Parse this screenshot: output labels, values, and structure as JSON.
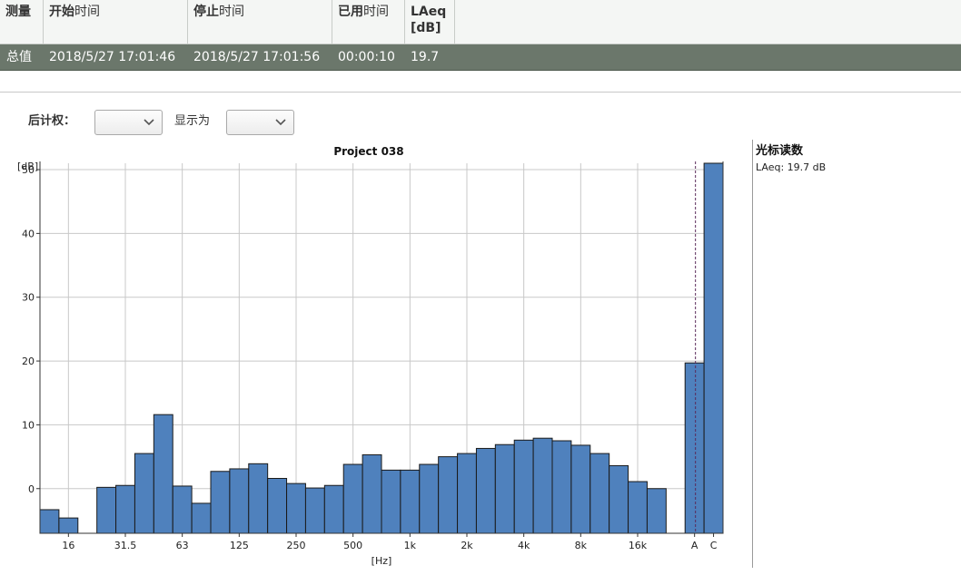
{
  "table": {
    "headers": [
      {
        "bold": "测量",
        "rest": ""
      },
      {
        "bold": "开始",
        "rest": "时间"
      },
      {
        "bold": "停止",
        "rest": "时间"
      },
      {
        "bold": "已用",
        "rest": "时间"
      },
      {
        "bold": "LAeq",
        "rest": "[dB]"
      }
    ],
    "row": [
      "总值",
      "2018/5/27 17:01:46",
      "2018/5/27 17:01:56",
      "00:00:10",
      "19.7"
    ]
  },
  "controls": {
    "weighting_label": "后计权：",
    "weighting_value": "",
    "display_label": "显示为",
    "display_value": ""
  },
  "cursor_panel": {
    "title": "光标读数",
    "reading": "LAeq: 19.7 dB"
  },
  "chart_data": {
    "type": "bar",
    "title": "Project 038",
    "ylabel": "[dB]",
    "xlabel": "[Hz]",
    "ylim": [
      -7,
      51
    ],
    "yticks": [
      0,
      10,
      20,
      30,
      40,
      50
    ],
    "grid": true,
    "x_tick_labels": [
      "16",
      "31.5",
      "63",
      "125",
      "250",
      "500",
      "1k",
      "2k",
      "4k",
      "8k",
      "16k",
      "A",
      "C"
    ],
    "bar_color": "#4f81bd",
    "cursor_band": "A",
    "bands": [
      {
        "f": "12.5",
        "v": -3.3
      },
      {
        "f": "16",
        "v": -4.6
      },
      {
        "f": "20",
        "v": null
      },
      {
        "f": "25",
        "v": 0.2
      },
      {
        "f": "31.5",
        "v": 0.5
      },
      {
        "f": "40",
        "v": 5.5
      },
      {
        "f": "50",
        "v": 11.6
      },
      {
        "f": "63",
        "v": 0.4
      },
      {
        "f": "80",
        "v": -2.3
      },
      {
        "f": "100",
        "v": 2.7
      },
      {
        "f": "125",
        "v": 3.1
      },
      {
        "f": "160",
        "v": 3.9
      },
      {
        "f": "200",
        "v": 1.6
      },
      {
        "f": "250",
        "v": 0.8
      },
      {
        "f": "315",
        "v": 0.1
      },
      {
        "f": "400",
        "v": 0.5
      },
      {
        "f": "500",
        "v": 3.8
      },
      {
        "f": "630",
        "v": 5.3
      },
      {
        "f": "800",
        "v": 2.9
      },
      {
        "f": "1k",
        "v": 2.9
      },
      {
        "f": "1.25k",
        "v": 3.8
      },
      {
        "f": "1.6k",
        "v": 5.0
      },
      {
        "f": "2k",
        "v": 5.5
      },
      {
        "f": "2.5k",
        "v": 6.3
      },
      {
        "f": "3.15k",
        "v": 6.9
      },
      {
        "f": "4k",
        "v": 7.6
      },
      {
        "f": "5k",
        "v": 7.9
      },
      {
        "f": "6.3k",
        "v": 7.5
      },
      {
        "f": "8k",
        "v": 6.8
      },
      {
        "f": "10k",
        "v": 5.5
      },
      {
        "f": "12.5k",
        "v": 3.6
      },
      {
        "f": "16k",
        "v": 1.1
      },
      {
        "f": "20k",
        "v": 0.0
      },
      {
        "f": "A",
        "v": 19.7
      },
      {
        "f": "C",
        "v": 51.0
      }
    ]
  }
}
